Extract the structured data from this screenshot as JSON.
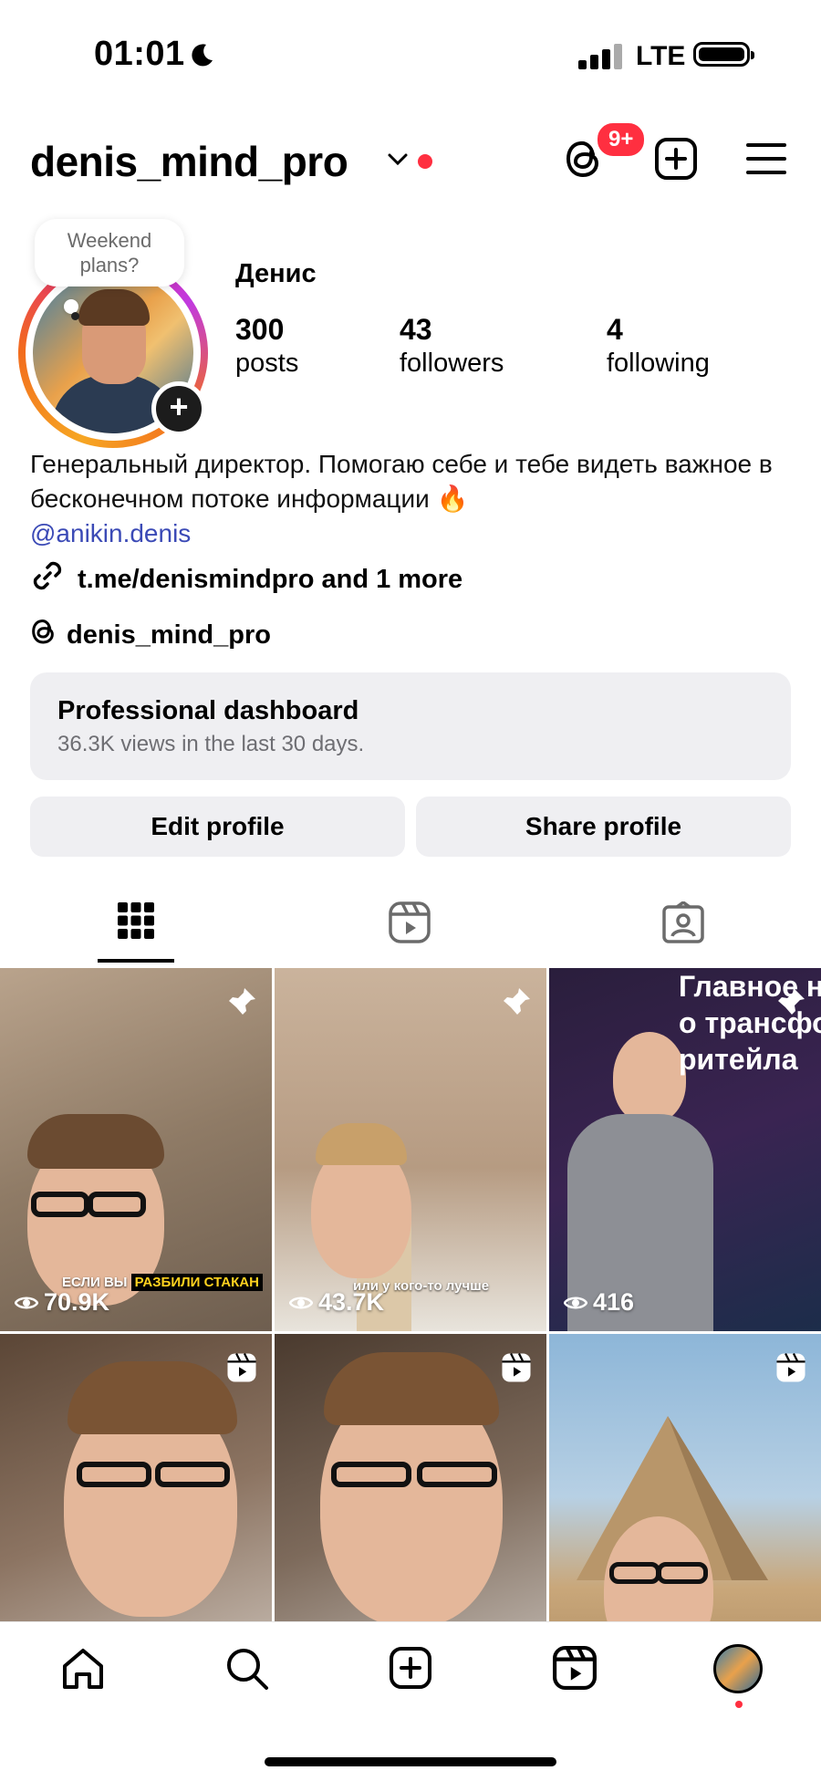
{
  "status_bar": {
    "time": "01:01",
    "network": "LTE",
    "moon_icon": "moon-icon"
  },
  "header": {
    "username": "denis_mind_pro",
    "notification_badge": "9+",
    "icons": [
      "threads-icon",
      "add-post-icon",
      "menu-icon"
    ]
  },
  "profile": {
    "note": "Weekend plans?",
    "display_name": "Денис",
    "stats": [
      {
        "value": "300",
        "label": "posts"
      },
      {
        "value": "43",
        "label": "followers"
      },
      {
        "value": "4",
        "label": "following"
      }
    ],
    "bio_line": "Генеральный директор. Помогаю себе и тебе видеть важное в бесконечном потоке информации 🔥",
    "mention": "@anikin.denis",
    "link": "t.me/denismindpro and 1 more",
    "threads_handle": "denis_mind_pro"
  },
  "dashboard": {
    "title": "Professional dashboard",
    "subtitle": "36.3K views in the last 30 days."
  },
  "buttons": {
    "edit": "Edit profile",
    "share": "Share profile"
  },
  "tabs": [
    "grid-icon",
    "reels-icon",
    "tagged-icon"
  ],
  "grid": [
    {
      "views": "70.9K",
      "icon": "pin-icon",
      "caption_plain": "ЕСЛИ ВЫ",
      "caption_highlight": "РАЗБИЛИ СТАКАН"
    },
    {
      "views": "43.7K",
      "icon": "pin-icon",
      "caption_plain": "или у кого-то лучше"
    },
    {
      "views": "416",
      "icon": "pin-icon",
      "slide_text": "Главное н\nо трансфо\nритейла"
    },
    {
      "icon": "reel-icon"
    },
    {
      "icon": "reel-icon"
    },
    {
      "icon": "reel-icon"
    }
  ],
  "nav": [
    "home-icon",
    "search-icon",
    "create-icon",
    "reels-icon",
    "profile-avatar"
  ],
  "colors": {
    "accent_red": "#ff2f40",
    "link_blue": "#3b4ab6",
    "surface": "#efeff2"
  }
}
